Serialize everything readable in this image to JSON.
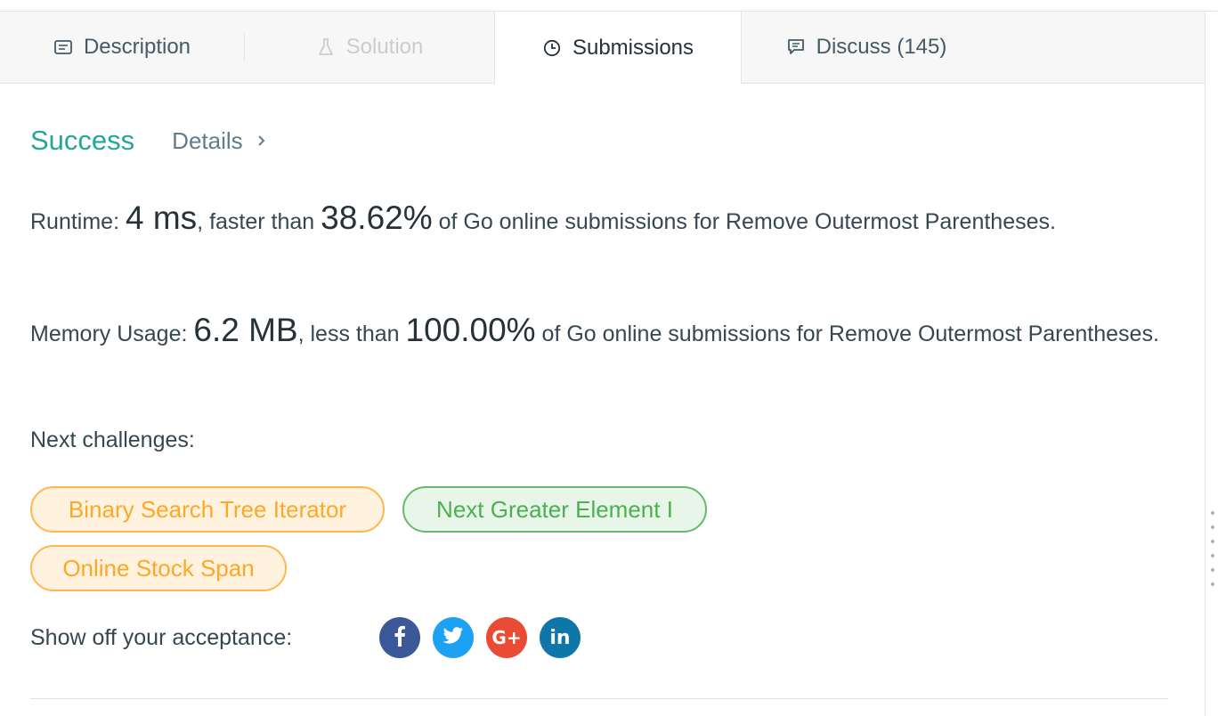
{
  "tabs": {
    "description": "Description",
    "solution": "Solution",
    "submissions": "Submissions",
    "discuss": "Discuss (145)"
  },
  "result": {
    "status": "Success",
    "details": "Details"
  },
  "runtime": {
    "label": "Runtime: ",
    "value": "4 ms",
    "mid": ", faster than ",
    "percent": "38.62%",
    "suffix": " of Go online submissions for Remove Outermost Parentheses."
  },
  "memory": {
    "label": "Memory Usage: ",
    "value": "6.2 MB",
    "mid": ", less than ",
    "percent": "100.00%",
    "suffix": " of Go online submissions for Remove Outermost Parentheses."
  },
  "next": {
    "label": "Next challenges:",
    "challenges": [
      {
        "name": "Binary Search Tree Iterator",
        "difficulty_color": "#ffa726"
      },
      {
        "name": "Next Greater Element I",
        "difficulty_color": "#4caf50"
      },
      {
        "name": "Online Stock Span",
        "difficulty_color": "#ffa726"
      }
    ]
  },
  "share": {
    "label": "Show off your acceptance:",
    "networks": [
      {
        "icon": "facebook-icon",
        "color": "#3b5998"
      },
      {
        "icon": "twitter-icon",
        "color": "#1da1f2"
      },
      {
        "icon": "google-plus-icon",
        "color": "#e94b35"
      },
      {
        "icon": "linkedin-icon",
        "color": "#0e76a8"
      }
    ]
  },
  "colors": {
    "success": "#26a69a",
    "medium": "#ffa726",
    "easy": "#4caf50"
  }
}
